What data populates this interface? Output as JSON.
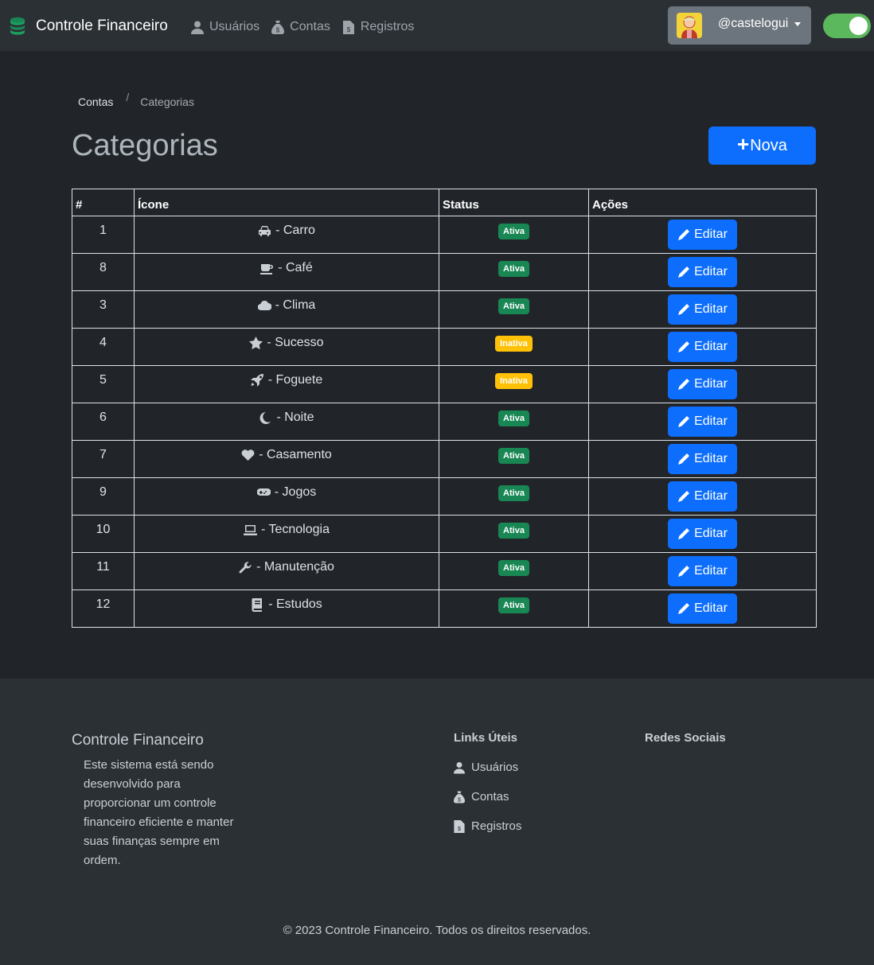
{
  "navbar": {
    "brand": "Controle Financeiro",
    "links": [
      {
        "label": "Usuários",
        "icon": "user-icon"
      },
      {
        "label": "Contas",
        "icon": "money-bag-icon"
      },
      {
        "label": "Registros",
        "icon": "invoice-icon"
      }
    ],
    "user": "@castelogui",
    "theme_toggle_on": true
  },
  "breadcrumb": {
    "parent": "Contas",
    "separator": "/",
    "current": "Categorias"
  },
  "page": {
    "title": "Categorias",
    "new_button": "Nova"
  },
  "table": {
    "headers": {
      "num": "#",
      "icon": "Ícone",
      "status": "Status",
      "actions": "Ações"
    },
    "edit_label": "Editar",
    "rows": [
      {
        "id": "1",
        "icon": "car-icon",
        "name": "- Carro",
        "status": "Ativa"
      },
      {
        "id": "8",
        "icon": "coffee-icon",
        "name": "- Café",
        "status": "Ativa"
      },
      {
        "id": "3",
        "icon": "cloud-icon",
        "name": "- Clima",
        "status": "Ativa"
      },
      {
        "id": "4",
        "icon": "star-icon",
        "name": "- Sucesso",
        "status": "Inativa"
      },
      {
        "id": "5",
        "icon": "rocket-icon",
        "name": "- Foguete",
        "status": "Inativa"
      },
      {
        "id": "6",
        "icon": "moon-icon",
        "name": "- Noite",
        "status": "Ativa"
      },
      {
        "id": "7",
        "icon": "heart-icon",
        "name": "- Casamento",
        "status": "Ativa"
      },
      {
        "id": "9",
        "icon": "gamepad-icon",
        "name": "- Jogos",
        "status": "Ativa"
      },
      {
        "id": "10",
        "icon": "laptop-icon",
        "name": "- Tecnologia",
        "status": "Ativa"
      },
      {
        "id": "11",
        "icon": "wrench-icon",
        "name": "- Manutenção",
        "status": "Ativa"
      },
      {
        "id": "12",
        "icon": "book-icon",
        "name": "- Estudos",
        "status": "Ativa"
      }
    ]
  },
  "footer": {
    "title": "Controle Financeiro",
    "description": "Este sistema está sendo desenvolvido para proporcionar um controle financeiro eficiente e manter suas finanças sempre em ordem.",
    "links_title": "Links Úteis",
    "links": [
      "Usuários",
      "Contas",
      "Registros"
    ],
    "social_title": "Redes Sociais",
    "copyright": "© 2023 Controle Financeiro. Todos os direitos reservados."
  },
  "colors": {
    "primary": "#0d6efd",
    "success": "#198754",
    "warning": "#ffc107",
    "background": "#212529",
    "navbar": "#2b3035",
    "toggle": "#5cb85c"
  }
}
